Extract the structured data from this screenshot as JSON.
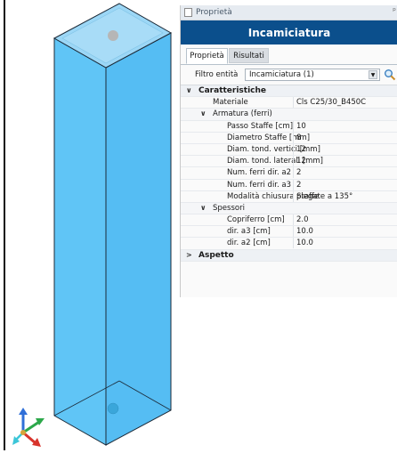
{
  "panel": {
    "title": "Proprietà",
    "pin_glyph": "ᵖ",
    "header": "Incamiciatura",
    "tabs": [
      "Proprietà",
      "Risultati"
    ],
    "filter": {
      "label": "Filtro entità",
      "value": "Incamiciatura (1)"
    },
    "icons": {
      "panel_icon": "panel-icon",
      "search": "search-icon",
      "dropdown": "chevron-down-icon"
    }
  },
  "tree": {
    "caratteristiche": {
      "label": "Caratteristiche",
      "materiale": {
        "name": "Materiale",
        "value": "Cls C25/30_B450C"
      },
      "armatura": {
        "label": "Armatura (ferri)",
        "rows": [
          {
            "name": "Passo Staffe  [cm]",
            "value": "10"
          },
          {
            "name": "Diametro Staffe  [mm]",
            "value": "8"
          },
          {
            "name": "Diam. tond. vertici  [mm]",
            "value": "12"
          },
          {
            "name": "Diam. tond. laterali  [mm]",
            "value": "12"
          },
          {
            "name": "Num. ferri dir. a2",
            "value": "2"
          },
          {
            "name": "Num. ferri dir. a3",
            "value": "2"
          },
          {
            "name": "Modalità chiusura Staffe",
            "value": "piegate a 135°"
          }
        ]
      },
      "spessori": {
        "label": "Spessori",
        "rows": [
          {
            "name": "Copriferro  [cm]",
            "value": "2.0"
          },
          {
            "name": "dir. a3  [cm]",
            "value": "10.0"
          },
          {
            "name": "dir. a2  [cm]",
            "value": "10.0"
          }
        ]
      }
    },
    "aspetto": {
      "label": "Aspetto"
    },
    "expander_open": "∨",
    "expander_closed": ">"
  },
  "viewport": {
    "object": "column-jacket-3d",
    "colors": {
      "face": "#5ec3f5",
      "top": "#a9ddf7",
      "edge": "#1c2a38",
      "dot": "#b8b8b8"
    }
  }
}
